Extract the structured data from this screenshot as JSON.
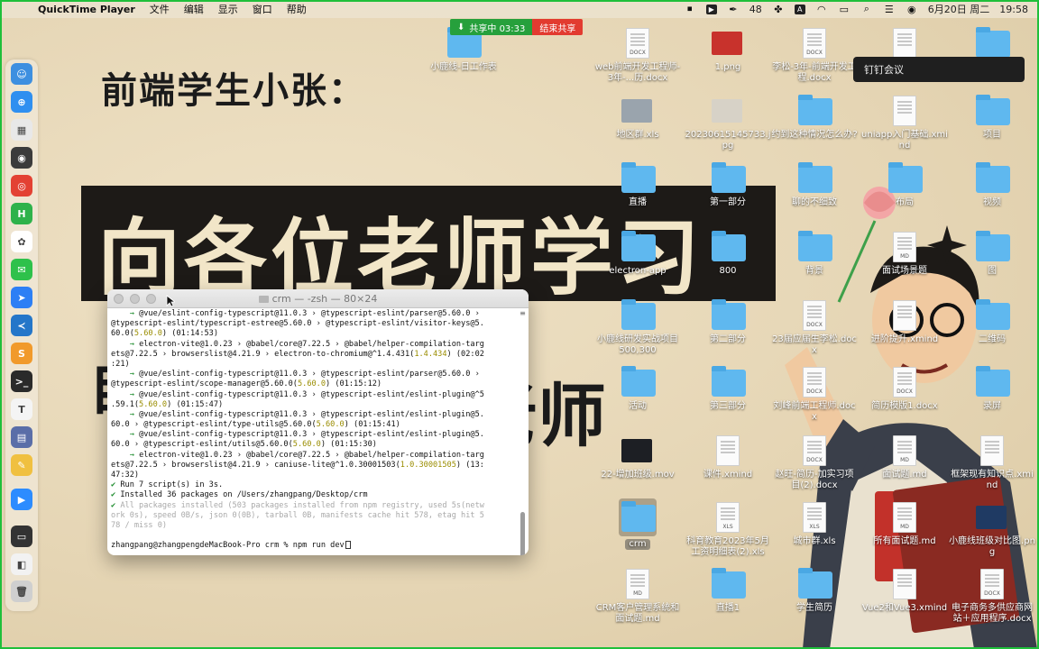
{
  "menubar": {
    "app_name": "QuickTime Player",
    "menus": [
      "文件",
      "编辑",
      "显示",
      "窗口",
      "帮助"
    ],
    "status": {
      "battery_text": "48",
      "date": "6月20日 周二",
      "time": "19:58"
    }
  },
  "screen_share": {
    "status_label": "共享中 03:33",
    "end_label": "结束共享"
  },
  "meeting_tooltip": "钉钉会议",
  "wallpaper": {
    "line1": "前端学生小张：",
    "line2": "向各位老师学习",
    "line3": "老师",
    "line3_left": "自"
  },
  "dock": {
    "items": [
      {
        "name": "finder-icon",
        "color": "#3d8fe0",
        "glyph": "☺"
      },
      {
        "name": "safari-icon",
        "color": "#2f8ff0",
        "glyph": "⊕"
      },
      {
        "name": "launchpad-icon",
        "color": "#e8e8e8",
        "glyph": "▦"
      },
      {
        "name": "qq-icon",
        "color": "#3b3b3b",
        "glyph": "◉"
      },
      {
        "name": "chrome-icon",
        "color": "#e34133",
        "glyph": "◎"
      },
      {
        "name": "hbuilder-icon",
        "color": "#2eb24b",
        "glyph": "H"
      },
      {
        "name": "lark-icon",
        "color": "#ffffff",
        "glyph": "✿"
      },
      {
        "name": "wechat-icon",
        "color": "#2ec14b",
        "glyph": "✉"
      },
      {
        "name": "dingtalk-icon",
        "color": "#2d7ff5",
        "glyph": "➤"
      },
      {
        "name": "vscode-icon",
        "color": "#2476c9",
        "glyph": "≺"
      },
      {
        "name": "sublime-icon",
        "color": "#f19a2b",
        "glyph": "S"
      },
      {
        "name": "terminal-icon",
        "color": "#2a2a2a",
        "glyph": ">_"
      },
      {
        "name": "typora-icon",
        "color": "#f4f4f4",
        "glyph": "T"
      },
      {
        "name": "preview-icon",
        "color": "#5a6ea8",
        "glyph": "▤"
      },
      {
        "name": "paint-icon",
        "color": "#f0c040",
        "glyph": "✎"
      },
      {
        "name": "zoom-icon",
        "color": "#2d8cff",
        "glyph": "▶"
      },
      {
        "name": "screen-recorder-icon",
        "color": "#333333",
        "glyph": "▭"
      },
      {
        "name": "chrome-window-icon",
        "color": "#f2f2f2",
        "glyph": "◧"
      },
      {
        "name": "trash-icon",
        "color": "#cfcfcf",
        "glyph": "🗑"
      }
    ]
  },
  "desktop_items": [
    {
      "label": "小鹿线-日工作表",
      "type": "folder"
    },
    {
      "label": "web前端开发工程师-3年-...历.docx",
      "type": "doc",
      "ext": "DOCX"
    },
    {
      "label": "1.png",
      "type": "img",
      "color": "#c8322c"
    },
    {
      "label": "李松-3年-前端开发工程.docx",
      "type": "doc",
      "ext": "DOCX"
    },
    {
      "label": "",
      "type": "doc",
      "ext": ""
    },
    {
      "label": "",
      "type": "folder"
    },
    {
      "label": "地区群.xls",
      "type": "img",
      "color": "#9aa4ad"
    },
    {
      "label": "20230615145733.jpg",
      "type": "img",
      "color": "#d7d2c7"
    },
    {
      "label": "约到这种情况怎么办?",
      "type": "folder"
    },
    {
      "label": "uniapp入门基础.xmind",
      "type": "doc",
      "ext": ""
    },
    {
      "label": "项目",
      "type": "folder"
    },
    {
      "label": "直播",
      "type": "folder"
    },
    {
      "label": "第一部分",
      "type": "folder"
    },
    {
      "label": "聊的不细致",
      "type": "folder"
    },
    {
      "label": "布局",
      "type": "folder"
    },
    {
      "label": "视频",
      "type": "folder"
    },
    {
      "label": "electron-app",
      "type": "folder"
    },
    {
      "label": "800",
      "type": "folder"
    },
    {
      "label": "背景",
      "type": "folder"
    },
    {
      "label": "面试场景题",
      "type": "doc",
      "ext": "MD"
    },
    {
      "label": "图",
      "type": "folder"
    },
    {
      "label": "小鹿线研发实战项目500,300",
      "type": "folder"
    },
    {
      "label": "第二部分",
      "type": "folder"
    },
    {
      "label": "23届应届生李松.docx",
      "type": "doc",
      "ext": "DOCX"
    },
    {
      "label": "进阶提升.xmind",
      "type": "doc",
      "ext": ""
    },
    {
      "label": "二维码",
      "type": "folder"
    },
    {
      "label": "活动",
      "type": "folder"
    },
    {
      "label": "第三部分",
      "type": "folder"
    },
    {
      "label": "刘峰前端工程师.docx",
      "type": "doc",
      "ext": "DOCX"
    },
    {
      "label": "简历模版1.docx",
      "type": "doc",
      "ext": "DOCX"
    },
    {
      "label": "录屏",
      "type": "folder"
    },
    {
      "label": "22-增加班级.mov",
      "type": "img",
      "color": "#1d1f24"
    },
    {
      "label": "课件.xmind",
      "type": "doc",
      "ext": ""
    },
    {
      "label": "赵旺-简历-加实习项目(2).docx",
      "type": "doc",
      "ext": "DOCX"
    },
    {
      "label": "面试题.md",
      "type": "doc",
      "ext": "MD"
    },
    {
      "label": "框架现有知识点.xmind",
      "type": "doc",
      "ext": ""
    },
    {
      "label": "crm",
      "type": "folder",
      "selected": true
    },
    {
      "label": "科育教育2023年5月工资明细表(2).xls",
      "type": "doc",
      "ext": "XLS"
    },
    {
      "label": "城市群.xls",
      "type": "doc",
      "ext": "XLS"
    },
    {
      "label": "所有面试题.md",
      "type": "doc",
      "ext": "MD"
    },
    {
      "label": "小鹿线班级对比图.png",
      "type": "img",
      "color": "#1f3a63"
    },
    {
      "label": "CRM客户管理系统和面试题.md",
      "type": "doc",
      "ext": "MD"
    },
    {
      "label": "直播1",
      "type": "folder"
    },
    {
      "label": "学生简历",
      "type": "folder"
    },
    {
      "label": "Vue2和Vue3.xmind",
      "type": "doc",
      "ext": ""
    },
    {
      "label": "电子商务多供应商网站＋应用程序.docx",
      "type": "doc",
      "ext": "DOCX"
    }
  ],
  "terminal": {
    "title": "crm — -zsh — 80×24",
    "lines": [
      {
        "parts": [
          [
            "",
            "    "
          ],
          [
            "green",
            "→"
          ],
          [
            "",
            " @vue/eslint-config-typescript@11.0.3 › @typescript-eslint/parser@5.60.0 ›"
          ]
        ]
      },
      {
        "parts": [
          [
            "",
            "@typescript-eslint/typescript-estree@5.60.0 › @typescript-eslint/visitor-keys@5."
          ]
        ]
      },
      {
        "parts": [
          [
            "",
            "60.0("
          ],
          [
            "yel",
            "5.60.0"
          ],
          [
            "",
            ") (01:14:53)"
          ]
        ]
      },
      {
        "parts": [
          [
            "",
            "    "
          ],
          [
            "green",
            "→"
          ],
          [
            "",
            " electron-vite@1.0.23 › @babel/core@7.22.5 › @babel/helper-compilation-targ"
          ]
        ]
      },
      {
        "parts": [
          [
            "",
            "ets@7.22.5 › browserslist@4.21.9 › electron-to-chromium@^1.4.431("
          ],
          [
            "yel",
            "1.4.434"
          ],
          [
            "",
            ") (02:02"
          ]
        ]
      },
      {
        "parts": [
          [
            "",
            ":21)"
          ]
        ]
      },
      {
        "parts": [
          [
            "",
            "    "
          ],
          [
            "green",
            "→"
          ],
          [
            "",
            " @vue/eslint-config-typescript@11.0.3 › @typescript-eslint/parser@5.60.0 ›"
          ]
        ]
      },
      {
        "parts": [
          [
            "",
            "@typescript-eslint/scope-manager@5.60.0("
          ],
          [
            "yel",
            "5.60.0"
          ],
          [
            "",
            ") (01:15:12)"
          ]
        ]
      },
      {
        "parts": [
          [
            "",
            "    "
          ],
          [
            "green",
            "→"
          ],
          [
            "",
            " @vue/eslint-config-typescript@11.0.3 › @typescript-eslint/eslint-plugin@^5"
          ]
        ]
      },
      {
        "parts": [
          [
            "",
            ".59.1("
          ],
          [
            "yel",
            "5.60.0"
          ],
          [
            "",
            ") (01:15:47)"
          ]
        ]
      },
      {
        "parts": [
          [
            "",
            "    "
          ],
          [
            "green",
            "→"
          ],
          [
            "",
            " @vue/eslint-config-typescript@11.0.3 › @typescript-eslint/eslint-plugin@5."
          ]
        ]
      },
      {
        "parts": [
          [
            "",
            "60.0 › @typescript-eslint/type-utils@5.60.0("
          ],
          [
            "yel",
            "5.60.0"
          ],
          [
            "",
            ") (01:15:41)"
          ]
        ]
      },
      {
        "parts": [
          [
            "",
            "    "
          ],
          [
            "green",
            "→"
          ],
          [
            "",
            " @vue/eslint-config-typescript@11.0.3 › @typescript-eslint/eslint-plugin@5."
          ]
        ]
      },
      {
        "parts": [
          [
            "",
            "60.0 › @typescript-eslint/utils@5.60.0("
          ],
          [
            "yel",
            "5.60.0"
          ],
          [
            "",
            ") (01:15:30)"
          ]
        ]
      },
      {
        "parts": [
          [
            "",
            "    "
          ],
          [
            "green",
            "→"
          ],
          [
            "",
            " electron-vite@1.0.23 › @babel/core@7.22.5 › @babel/helper-compilation-targ"
          ]
        ]
      },
      {
        "parts": [
          [
            "",
            "ets@7.22.5 › browserslist@4.21.9 › caniuse-lite@^1.0.30001503("
          ],
          [
            "yel",
            "1.0.30001505"
          ],
          [
            "",
            ") (13:"
          ]
        ]
      },
      {
        "parts": [
          [
            "",
            "47:32)"
          ]
        ]
      },
      {
        "parts": [
          [
            "green",
            "✔"
          ],
          [
            "",
            " Run 7 script(s) in 3s."
          ]
        ]
      },
      {
        "parts": [
          [
            "green",
            "✔"
          ],
          [
            "",
            " Installed 36 packages on /Users/zhangpang/Desktop/crm"
          ]
        ]
      },
      {
        "parts": [
          [
            "green",
            "✔"
          ],
          [
            "dim",
            " All packages installed (503 packages installed from npm registry, used 5s(netw"
          ]
        ]
      },
      {
        "parts": [
          [
            "dim",
            "ork 0s), speed 0B/s, json 0(0B), tarball 0B, manifests cache hit 578, etag hit 5"
          ]
        ]
      },
      {
        "parts": [
          [
            "dim",
            "78 / miss 0)"
          ]
        ]
      },
      {
        "parts": [
          [
            "",
            " "
          ]
        ]
      },
      {
        "parts": [
          [
            "",
            "zhangpang@zhangpengdeMacBook-Pro crm % npm run dev"
          ]
        ],
        "cursor": true
      }
    ]
  }
}
